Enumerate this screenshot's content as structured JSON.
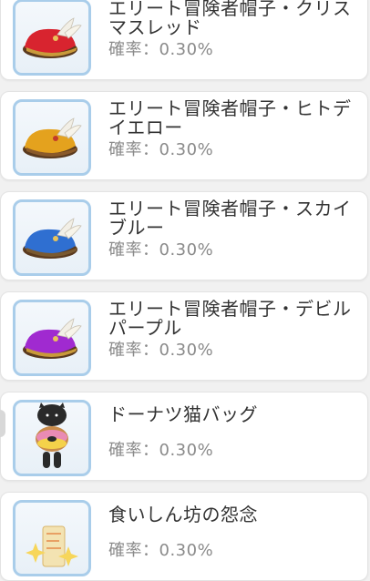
{
  "items": [
    {
      "name": "エリート冒険者帽子・クリスマスレッド",
      "rate": "確率：0.30%",
      "icon": "red-hat-icon",
      "color": "#d8242f"
    },
    {
      "name": "エリート冒険者帽子・ヒトデイエロー",
      "rate": "確率：0.30%",
      "icon": "yellow-hat-icon",
      "color": "#e4a21e"
    },
    {
      "name": "エリート冒険者帽子・スカイブルー",
      "rate": "確率：0.30%",
      "icon": "blue-hat-icon",
      "color": "#2f6fd1"
    },
    {
      "name": "エリート冒険者帽子・デビルパープル",
      "rate": "確率：0.30%",
      "icon": "purple-hat-icon",
      "color": "#a02ad0"
    },
    {
      "name": "ドーナツ猫バッグ",
      "rate": "確率：0.30%",
      "icon": "donut-cat-bag-icon",
      "color": "#2a2a2a"
    },
    {
      "name": "食いしん坊の怨念",
      "rate": "確率：0.30%",
      "icon": "sparkle-scroll-icon",
      "color": "#f1c343"
    }
  ]
}
